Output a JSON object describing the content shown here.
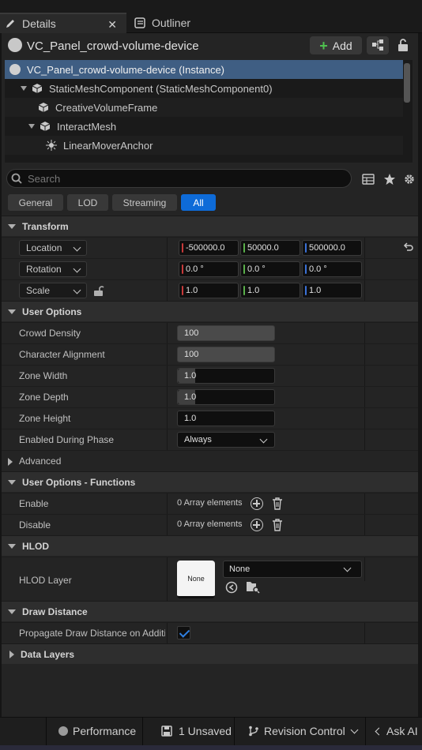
{
  "tabs": [
    {
      "label": "Details",
      "active": true
    },
    {
      "label": "Outliner",
      "active": false
    }
  ],
  "header": {
    "title": "VC_Panel_crowd-volume-device",
    "add_label": "Add"
  },
  "tree": [
    {
      "label": "VC_Panel_crowd-volume-device (Instance)",
      "depth": 0,
      "selected": true
    },
    {
      "label": "StaticMeshComponent (StaticMeshComponent0)",
      "depth": 1
    },
    {
      "label": "CreativeVolumeFrame",
      "depth": 2
    },
    {
      "label": "InteractMesh",
      "depth": 1
    },
    {
      "label": "LinearMoverAnchor",
      "depth": 3
    }
  ],
  "search": {
    "placeholder": "Search"
  },
  "filters": [
    "General",
    "LOD",
    "Streaming",
    "All"
  ],
  "active_filter": "All",
  "transform": {
    "title": "Transform",
    "location": {
      "label": "Location",
      "x": "-500000.0",
      "y": "50000.0",
      "z": "500000.0"
    },
    "rotation": {
      "label": "Rotation",
      "x": "0.0 °",
      "y": "0.0 °",
      "z": "0.0 °"
    },
    "scale": {
      "label": "Scale",
      "x": "1.0",
      "y": "1.0",
      "z": "1.0"
    }
  },
  "user_options": {
    "title": "User Options",
    "crowd_density": {
      "label": "Crowd Density",
      "value": "100"
    },
    "character_alignment": {
      "label": "Character Alignment",
      "value": "100"
    },
    "zone_width": {
      "label": "Zone Width",
      "value": "1.0"
    },
    "zone_depth": {
      "label": "Zone Depth",
      "value": "1.0"
    },
    "zone_height": {
      "label": "Zone Height",
      "value": "1.0"
    },
    "enabled_during_phase": {
      "label": "Enabled During Phase",
      "value": "Always"
    },
    "advanced": "Advanced"
  },
  "functions": {
    "title": "User Options - Functions",
    "enable": {
      "label": "Enable",
      "value": "0 Array elements"
    },
    "disable": {
      "label": "Disable",
      "value": "0 Array elements"
    }
  },
  "hlod": {
    "title": "HLOD",
    "layer_label": "HLOD Layer",
    "thumb": "None",
    "combo": "None"
  },
  "draw_distance": {
    "title": "Draw Distance",
    "propagate_label": "Propagate Draw Distance on Additi...",
    "propagate_checked": true
  },
  "data_layers": {
    "title": "Data Layers"
  },
  "statusbar": {
    "performance": "Performance",
    "unsaved": "1 Unsaved",
    "revision": "Revision Control",
    "ask_ai": "Ask AI"
  },
  "colors": {
    "accent": "#0e6bd8",
    "selection": "#3f5e83",
    "x_axis": "#c83a3a",
    "y_axis": "#5ab04a",
    "z_axis": "#3a72d8"
  }
}
